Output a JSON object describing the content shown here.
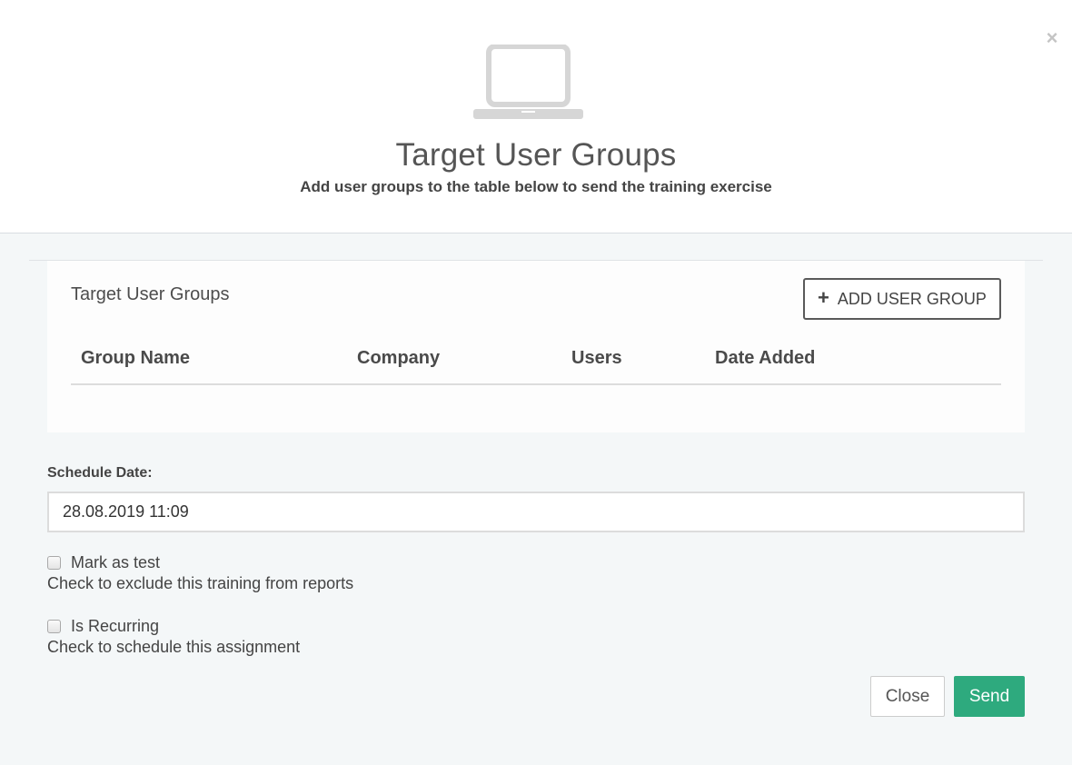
{
  "modal": {
    "title": "Target User Groups",
    "subtitle": "Add user groups to the table below to send the training exercise",
    "close_icon": "close-icon",
    "header_icon": "laptop-icon"
  },
  "groups_panel": {
    "title": "Target User Groups",
    "add_button_label": "ADD USER GROUP",
    "add_button_icon": "plus-icon",
    "columns": [
      "Group Name",
      "Company",
      "Users",
      "Date Added"
    ],
    "rows": []
  },
  "schedule": {
    "label": "Schedule Date:",
    "value": "28.08.2019 11:09"
  },
  "options": {
    "mark_as_test": {
      "label": "Mark as test",
      "help": "Check to exclude this training from reports",
      "checked": false
    },
    "is_recurring": {
      "label": "Is Recurring",
      "help": "Check to schedule this assignment",
      "checked": false
    }
  },
  "footer": {
    "close_label": "Close",
    "send_label": "Send"
  },
  "colors": {
    "send_button": "#2eaa7e",
    "background": "#f4f7f8"
  }
}
